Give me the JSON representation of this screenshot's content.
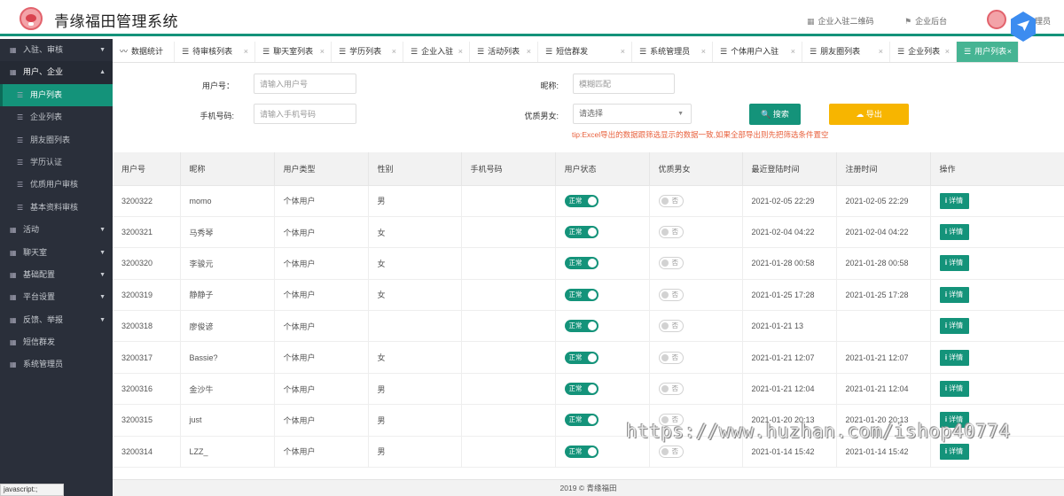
{
  "header": {
    "app_title": "青缘福田管理系统",
    "links": [
      {
        "icon": "qrcode-icon",
        "label": "企业入驻二维码"
      },
      {
        "icon": "flag-icon",
        "label": "企业后台"
      }
    ],
    "user_name": "理员"
  },
  "sidebar": {
    "items": [
      {
        "label": "入驻、审核",
        "icon": "grid-icon",
        "arrow": "▼",
        "kind": "group"
      },
      {
        "label": "用户、企业",
        "icon": "grid-icon",
        "arrow": "▲",
        "kind": "group-open"
      },
      {
        "label": "用户列表",
        "icon": "list-icon",
        "arrow": "",
        "kind": "sub-active"
      },
      {
        "label": "企业列表",
        "icon": "list-icon",
        "arrow": "",
        "kind": "sub"
      },
      {
        "label": "朋友圈列表",
        "icon": "list-icon",
        "arrow": "",
        "kind": "sub"
      },
      {
        "label": "学历认证",
        "icon": "list-icon",
        "arrow": "",
        "kind": "sub"
      },
      {
        "label": "优质用户审核",
        "icon": "list-icon",
        "arrow": "",
        "kind": "sub"
      },
      {
        "label": "基本资料审核",
        "icon": "list-icon",
        "arrow": "",
        "kind": "sub"
      },
      {
        "label": "活动",
        "icon": "grid-icon",
        "arrow": "▼",
        "kind": "group"
      },
      {
        "label": "聊天室",
        "icon": "grid-icon",
        "arrow": "▼",
        "kind": "group"
      },
      {
        "label": "基础配置",
        "icon": "grid-icon",
        "arrow": "▼",
        "kind": "group"
      },
      {
        "label": "平台设置",
        "icon": "grid-icon",
        "arrow": "▼",
        "kind": "group"
      },
      {
        "label": "反馈、举报",
        "icon": "grid-icon",
        "arrow": "▼",
        "kind": "group"
      },
      {
        "label": "短信群发",
        "icon": "grid-icon",
        "arrow": "",
        "kind": "group"
      },
      {
        "label": "系统管理员",
        "icon": "grid-icon",
        "arrow": "",
        "kind": "group"
      }
    ],
    "status_tip": "javascript:;"
  },
  "tabs": [
    {
      "label": "数据统计",
      "icon": "chart-icon",
      "closable": false,
      "active": false
    },
    {
      "label": "待审核列表",
      "icon": "list-icon",
      "closable": true,
      "active": false
    },
    {
      "label": "聊天室列表",
      "icon": "list-icon",
      "closable": true,
      "active": false
    },
    {
      "label": "学历列表",
      "icon": "list-icon",
      "closable": true,
      "active": false
    },
    {
      "label": "企业入驻",
      "icon": "list-icon",
      "closable": true,
      "active": false
    },
    {
      "label": "活动列表",
      "icon": "list-icon",
      "closable": true,
      "active": false
    },
    {
      "label": "短信群发",
      "icon": "list-icon",
      "closable": true,
      "active": false
    },
    {
      "label": "系统管理员",
      "icon": "list-icon",
      "closable": true,
      "active": false
    },
    {
      "label": "个体用户入驻",
      "icon": "list-icon",
      "closable": true,
      "active": false
    },
    {
      "label": "朋友圈列表",
      "icon": "list-icon",
      "closable": true,
      "active": false
    },
    {
      "label": "企业列表",
      "icon": "list-icon",
      "closable": true,
      "active": false
    },
    {
      "label": "用户列表",
      "icon": "list-icon",
      "closable": true,
      "active": true
    }
  ],
  "search": {
    "user_id_label": "用户号：",
    "user_id_placeholder": "请输入用户号",
    "nickname_label": "昵称:",
    "nickname_placeholder": "模糊匹配",
    "phone_label": "手机号码:",
    "phone_placeholder": "请输入手机号码",
    "quality_label": "优质男女:",
    "quality_value": "请选择",
    "search_button": "搜索",
    "export_button": "导出",
    "tip": "tip:Excel导出的数据跟筛选显示的数据一致,如果全部导出则先把筛选条件置空"
  },
  "table": {
    "columns": [
      "用户号",
      "昵称",
      "用户类型",
      "性别",
      "手机号码",
      "用户状态",
      "优质男女",
      "最近登陆时间",
      "注册时间",
      "操作"
    ],
    "status_label": "正常",
    "quality_label": "否",
    "detail_label": "详情",
    "rows": [
      {
        "id": "3200322",
        "nickname": "momo",
        "type": "个体用户",
        "gender": "男",
        "phone": "",
        "last_login": "2021-02-05 22:29",
        "registered": "2021-02-05 22:29"
      },
      {
        "id": "3200321",
        "nickname": "马秀琴",
        "type": "个体用户",
        "gender": "女",
        "phone": "",
        "last_login": "2021-02-04 04:22",
        "registered": "2021-02-04 04:22"
      },
      {
        "id": "3200320",
        "nickname": "李骏元",
        "type": "个体用户",
        "gender": "女",
        "phone": "",
        "last_login": "2021-01-28 00:58",
        "registered": "2021-01-28 00:58"
      },
      {
        "id": "3200319",
        "nickname": "静静子",
        "type": "个体用户",
        "gender": "女",
        "phone": "",
        "last_login": "2021-01-25 17:28",
        "registered": "2021-01-25 17:28"
      },
      {
        "id": "3200318",
        "nickname": "廖俊谚",
        "type": "个体用户",
        "gender": "",
        "phone": "",
        "last_login": "2021-01-21 13",
        "registered": ""
      },
      {
        "id": "3200317",
        "nickname": "Bassie?",
        "type": "个体用户",
        "gender": "女",
        "phone": "",
        "last_login": "2021-01-21 12:07",
        "registered": "2021-01-21 12:07"
      },
      {
        "id": "3200316",
        "nickname": "金沙牛",
        "type": "个体用户",
        "gender": "男",
        "phone": "",
        "last_login": "2021-01-21 12:04",
        "registered": "2021-01-21 12:04"
      },
      {
        "id": "3200315",
        "nickname": "just",
        "type": "个体用户",
        "gender": "男",
        "phone": "",
        "last_login": "2021-01-20 20:13",
        "registered": "2021-01-20 20:13"
      },
      {
        "id": "3200314",
        "nickname": "LZZ_",
        "type": "个体用户",
        "gender": "男",
        "phone": "",
        "last_login": "2021-01-14 15:42",
        "registered": "2021-01-14 15:42"
      }
    ]
  },
  "footer": "2019 © 青缘福田",
  "watermark": "https://www.huzhan.com/ishop40774"
}
